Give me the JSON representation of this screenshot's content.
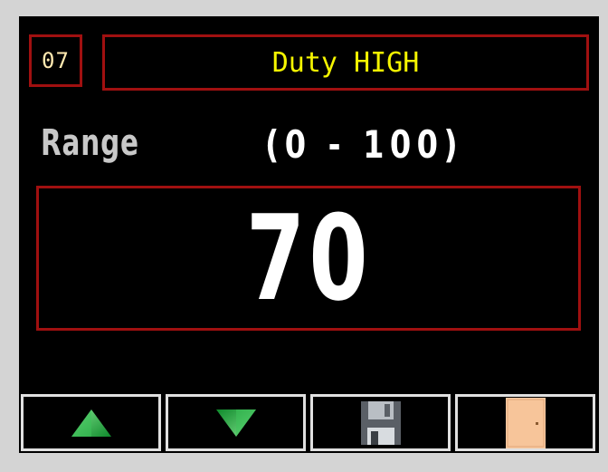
{
  "header": {
    "code": "07",
    "title": "Duty HIGH"
  },
  "range": {
    "label": "Range",
    "text": "(0 - 100)"
  },
  "value": {
    "current": "70"
  },
  "buttons": [
    {
      "name": "up",
      "icon": "arrow-up-icon"
    },
    {
      "name": "down",
      "icon": "arrow-down-icon"
    },
    {
      "name": "save",
      "icon": "floppy-disk-icon"
    },
    {
      "name": "exit",
      "icon": "door-icon"
    }
  ],
  "colors": {
    "screen_bg": "#000000",
    "frame_bg": "#d4d4d4",
    "border_red": "#a01010",
    "title_yellow": "#f5f500",
    "code_text": "#ffe9b0",
    "arrow_green": "#22b04a"
  }
}
